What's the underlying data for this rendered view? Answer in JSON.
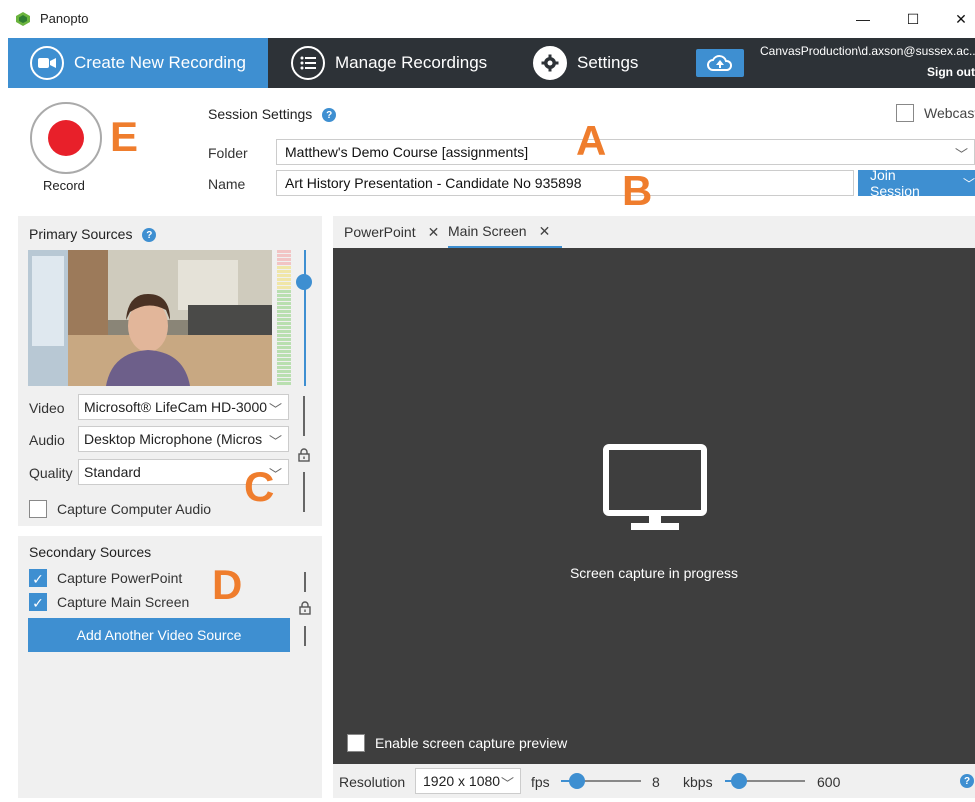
{
  "window": {
    "title": "Panopto",
    "minimize": "—",
    "maximize": "☐",
    "close": "✕"
  },
  "nav": {
    "tabs": [
      {
        "label": "Create New Recording",
        "icon": "video-camera-icon",
        "active": true
      },
      {
        "label": "Manage Recordings",
        "icon": "list-icon",
        "active": false
      },
      {
        "label": "Settings",
        "icon": "gear-icon",
        "active": false
      }
    ],
    "upload_icon": "cloud-upload-icon",
    "user": "CanvasProduction\\d.axson@sussex.ac...",
    "sign_out": "Sign out"
  },
  "session": {
    "record_label": "Record",
    "title": "Session Settings",
    "help": "?",
    "folder_label": "Folder",
    "folder_value": "Matthew's Demo Course [assignments]",
    "name_label": "Name",
    "name_value": "Art History Presentation - Candidate No 935898",
    "join_label": "Join Session",
    "webcast_label": "Webcast"
  },
  "annotations": {
    "a": "A",
    "b": "B",
    "c": "C",
    "d": "D",
    "e": "E"
  },
  "primary": {
    "title": "Primary Sources",
    "video_label": "Video",
    "video_value": "Microsoft® LifeCam HD-3000",
    "audio_label": "Audio",
    "audio_value": "Desktop Microphone (Micros",
    "quality_label": "Quality",
    "quality_value": "Standard",
    "capture_audio_label": "Capture Computer Audio",
    "capture_audio_checked": false
  },
  "secondary": {
    "title": "Secondary Sources",
    "items": [
      {
        "label": "Capture PowerPoint",
        "checked": true
      },
      {
        "label": "Capture Main Screen",
        "checked": true
      }
    ],
    "add_button": "Add Another Video Source"
  },
  "capture": {
    "tabs": [
      {
        "label": "PowerPoint",
        "active": false
      },
      {
        "label": "Main Screen",
        "active": true
      }
    ],
    "tab_close": "✕",
    "status": "Screen capture in progress",
    "preview_label": "Enable screen capture preview",
    "resolution_label": "Resolution",
    "resolution_value": "1920 x 1080",
    "fps_label": "fps",
    "fps_value": "8",
    "kbps_label": "kbps",
    "kbps_value": "600"
  },
  "colors": {
    "accent": "#3e8fd1",
    "nav_bg": "#2d3237",
    "record": "#e8202a",
    "annotation": "#ef7d2d",
    "capture_bg": "#3e3e3e"
  }
}
